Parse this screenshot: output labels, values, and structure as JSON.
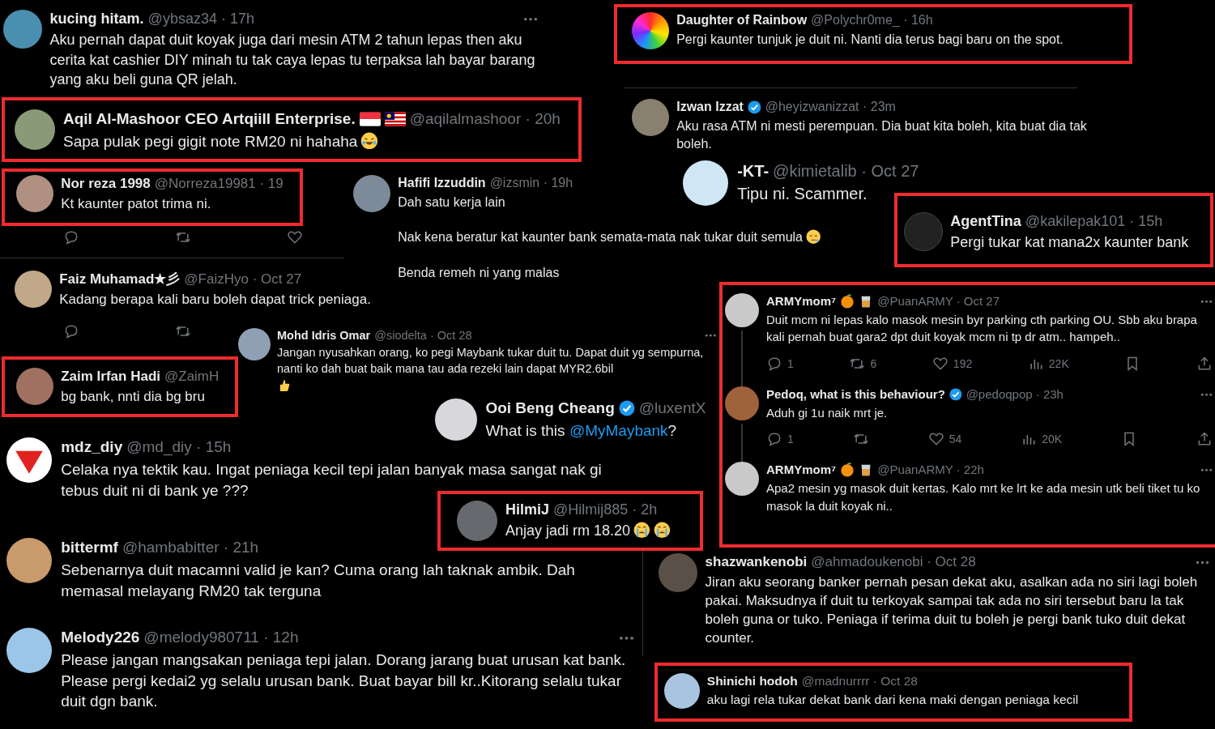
{
  "tweets": [
    {
      "name": "kucing hitam.",
      "meta": "@ybsaz34 · 17h",
      "verified": false,
      "highlighted": false,
      "more_menu": true,
      "paragraphs": [
        "Aku pernah dapat duit koyak juga dari mesin ATM 2 tahun lepas then aku cerita kat cashier DIY minah tu tak caya lepas tu terpaksa lah bayar barang yang aku beli guna QR jelah."
      ]
    },
    {
      "name": "Aqil Al-Mashoor CEO Artqiill Enterprise.",
      "meta": "@aqilalmashoor · 20h",
      "verified": false,
      "highlighted": true,
      "more_menu": false,
      "paragraphs": [
        "Sapa pulak pegi gigit note RM20 ni hahaha"
      ]
    },
    {
      "name": "Nor reza 1998",
      "meta": "@Norreza19981 · 19",
      "verified": false,
      "highlighted": true,
      "more_menu": false,
      "paragraphs": [
        "Kt kaunter patot trima ni."
      ],
      "actions": [
        {
          "kind": "reply"
        },
        {
          "kind": "retweet"
        },
        {
          "kind": "like"
        }
      ]
    },
    {
      "name": "Hafifi Izzuddin",
      "meta": "@izsmin · 19h",
      "verified": false,
      "highlighted": false,
      "more_menu": false,
      "paragraphs": [
        "Dah satu kerja lain",
        "Nak kena beratur kat kaunter bank semata-mata nak tukar duit semula",
        "Benda remeh ni yang malas"
      ]
    },
    {
      "name": "Faiz Muhamad★彡",
      "meta": "@FaizHyo · Oct 27",
      "verified": false,
      "highlighted": false,
      "more_menu": false,
      "paragraphs": [
        "Kadang berapa kali baru boleh dapat trick peniaga."
      ],
      "actions": [
        {
          "kind": "reply"
        },
        {
          "kind": "retweet"
        }
      ]
    },
    {
      "name": "Zaim Irfan Hadi",
      "meta": "@ZaimH",
      "verified": false,
      "highlighted": true,
      "more_menu": false,
      "paragraphs": [
        "bg bank, nnti dia bg bru"
      ]
    },
    {
      "name": "Mohd Idris Omar",
      "meta": "@siodelta · Oct 28",
      "verified": false,
      "highlighted": false,
      "more_menu": true,
      "paragraphs": [
        "Jangan nyusahkan orang, ko pegi Maybank tukar duit tu. Dapat duit yg sempurna, nanti ko dah buat baik mana tau ada rezeki lain dapat MYR2.6bil"
      ]
    },
    {
      "name": "Ooi Beng Cheang",
      "meta": "@luxentX",
      "verified": true,
      "highlighted": false,
      "more_menu": false,
      "paragraphs": [
        {
          "segments": [
            {
              "kind": "plain",
              "text": "What is this "
            },
            {
              "kind": "mention",
              "text": "@MyMaybank"
            },
            {
              "kind": "plain",
              "text": "?"
            }
          ]
        }
      ]
    },
    {
      "name": "mdz_diy",
      "meta": "@md_diy · 15h",
      "verified": false,
      "highlighted": false,
      "more_menu": false,
      "paragraphs": [
        "Celaka nya tektik kau. Ingat peniaga kecil tepi jalan banyak masa sangat nak gi tebus duit ni di bank ye ???"
      ]
    },
    {
      "name": "HilmiJ",
      "meta": "@Hilmij885 · 2h",
      "verified": false,
      "highlighted": true,
      "more_menu": false,
      "paragraphs": [
        "Anjay jadi rm 18.20"
      ]
    },
    {
      "name": "bittermf",
      "meta": "@hambabitter · 21h",
      "verified": false,
      "highlighted": false,
      "more_menu": false,
      "paragraphs": [
        "Sebenarnya duit macamni valid je kan? Cuma orang lah taknak ambik. Dah memasal melayang RM20 tak terguna"
      ]
    },
    {
      "name": "Melody226",
      "meta": "@melody980711 · 12h",
      "verified": false,
      "highlighted": false,
      "more_menu": true,
      "paragraphs": [
        "Please jangan mangsakan peniaga tepi jalan. Dorang jarang buat urusan kat bank. Please pergi kedai2 yg selalu urusan bank. Buat bayar bill kr..Kitorang selalu tukar duit dgn bank."
      ]
    },
    {
      "name": "Daughter of Rainbow",
      "meta": "@Polychr0me_ · 16h",
      "verified": false,
      "highlighted": true,
      "more_menu": false,
      "paragraphs": [
        "Pergi kaunter tunjuk je duit ni. Nanti dia terus bagi baru on the spot."
      ]
    },
    {
      "name": "Izwan Izzat",
      "meta": "@heyizwanizzat · 23m",
      "verified": true,
      "highlighted": false,
      "more_menu": false,
      "paragraphs": [
        "Aku rasa ATM ni mesti perempuan. Dia buat kita boleh, kita buat dia tak boleh."
      ]
    },
    {
      "name": "-KT-",
      "meta": "@kimietalib · Oct 27",
      "verified": false,
      "highlighted": false,
      "more_menu": false,
      "paragraphs": [
        "Tipu ni. Scammer."
      ]
    },
    {
      "name": "AgentTina",
      "meta": "@kakilepak101 · 15h",
      "verified": false,
      "highlighted": true,
      "more_menu": false,
      "paragraphs": [
        "Pergi tukar kat mana2x kaunter bank"
      ]
    },
    {
      "name": "shazwankenobi",
      "meta": "@ahmadoukenobi · Oct 28",
      "verified": false,
      "highlighted": false,
      "more_menu": true,
      "paragraphs": [
        "Jiran aku seorang banker pernah pesan dekat aku, asalkan ada no siri lagi boleh pakai. Maksudnya if duit tu terkoyak sampai tak ada no siri tersebut baru la tak boleh guna or tuko. Peniaga if terima duit tu boleh je pergi bank tuko duit dekat counter."
      ]
    },
    {
      "name": "Shinichi hodoh",
      "meta": "@madnurrrr · Oct 28",
      "verified": false,
      "highlighted": true,
      "more_menu": false,
      "paragraphs": [
        "aku lagi rela tukar dekat bank dari kena maki dengan peniaga kecil"
      ]
    }
  ],
  "thread": {
    "highlighted": true,
    "tweets": [
      {
        "name": "ARMYmom⁷",
        "meta": "@PuanARMY · Oct 27",
        "verified": false,
        "more_menu": true,
        "text": "Duit mcm ni lepas kalo masok mesin byr parking cth parking OU.  Sbb aku brapa kali pernah buat gara2 dpt duit koyak mcm ni tp dr atm.. hampeh..",
        "actions": [
          {
            "kind": "reply",
            "count": "1"
          },
          {
            "kind": "retweet",
            "count": "6"
          },
          {
            "kind": "like",
            "count": "192"
          },
          {
            "kind": "views",
            "count": "22K"
          },
          {
            "kind": "bookmark"
          },
          {
            "kind": "share"
          }
        ]
      },
      {
        "name": "Pedoq, what is this behaviour?",
        "meta": "@pedoqpop · 23h",
        "verified": true,
        "more_menu": true,
        "text": "Aduh gi 1u naik mrt je.",
        "actions": [
          {
            "kind": "reply",
            "count": "1"
          },
          {
            "kind": "retweet"
          },
          {
            "kind": "like",
            "count": "54"
          },
          {
            "kind": "views",
            "count": "20K"
          },
          {
            "kind": "bookmark"
          },
          {
            "kind": "share"
          }
        ]
      },
      {
        "name": "ARMYmom⁷",
        "meta": "@PuanARMY · 22h",
        "verified": false,
        "more_menu": true,
        "text": "Apa2 mesin yg masok duit kertas. Kalo mrt ke lrt ke ada mesin utk beli tiket tu ko masok la duit koyak ni.."
      }
    ]
  }
}
